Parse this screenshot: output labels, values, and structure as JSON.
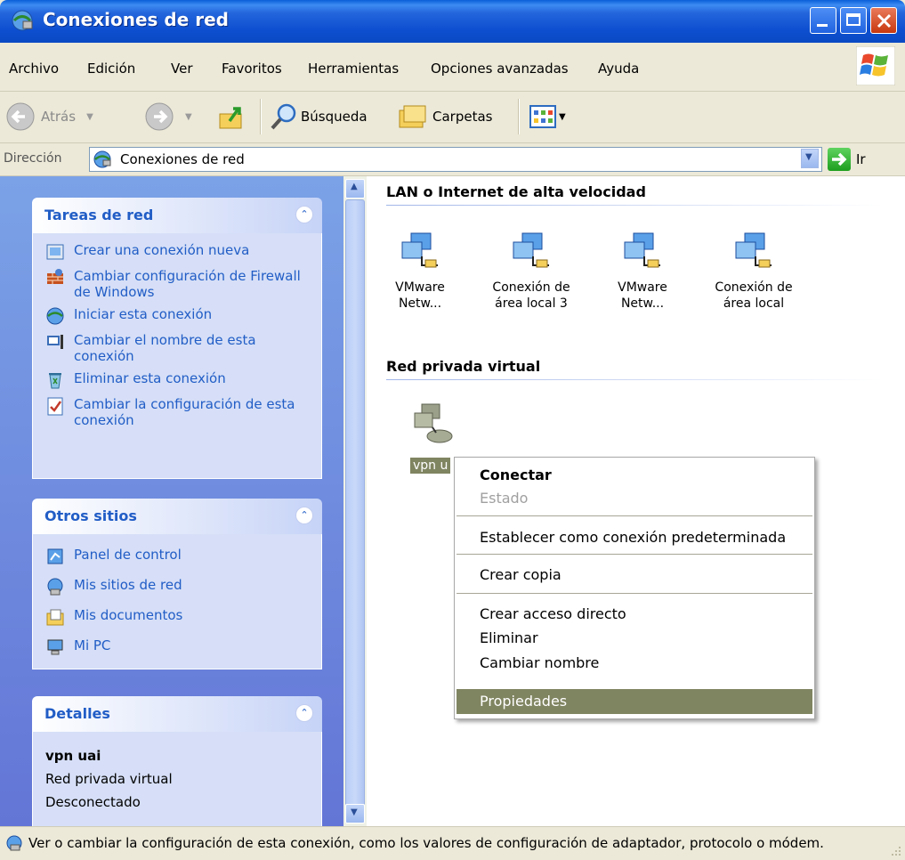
{
  "window": {
    "title": "Conexiones de red"
  },
  "menu": [
    "Archivo",
    "Edición",
    "Ver",
    "Favoritos",
    "Herramientas",
    "Opciones avanzadas",
    "Ayuda"
  ],
  "toolbar": {
    "back": "Atrás",
    "search": "Búsqueda",
    "folders": "Carpetas"
  },
  "address": {
    "label": "Dirección",
    "value": "Conexiones de red",
    "go": "Ir"
  },
  "tasks_panel": {
    "title": "Tareas de red",
    "items": [
      "Crear una conexión nueva",
      "Cambiar configuración de Firewall de Windows",
      "Iniciar esta conexión",
      "Cambiar el nombre de esta conexión",
      "Eliminar esta conexión",
      "Cambiar la configuración de esta conexión"
    ]
  },
  "places_panel": {
    "title": "Otros sitios",
    "items": [
      "Panel de control",
      "Mis sitios de red",
      "Mis documentos",
      "Mi PC"
    ]
  },
  "details_panel": {
    "title": "Detalles",
    "name": "vpn uai",
    "type": "Red privada virtual",
    "status": "Desconectado"
  },
  "groups": {
    "lan": {
      "title": "LAN o Internet de alta velocidad",
      "connections": [
        {
          "line1": "VMware",
          "line2": "Netw..."
        },
        {
          "line1": "Conexión de",
          "line2": "área local 3"
        },
        {
          "line1": "VMware",
          "line2": "Netw..."
        },
        {
          "line1": "Conexión de",
          "line2": "área local"
        }
      ]
    },
    "vpn": {
      "title": "Red privada virtual",
      "selected_label": "vpn u"
    }
  },
  "context_menu": {
    "connect": "Conectar",
    "status": "Estado",
    "set_default": "Establecer como conexión predeterminada",
    "copy": "Crear copia",
    "shortcut": "Crear acceso directo",
    "delete": "Eliminar",
    "rename": "Cambiar nombre",
    "properties": "Propiedades"
  },
  "statusbar": {
    "text": "Ver o cambiar la configuración de esta conexión, como los valores de configuración de adaptador, protocolo o módem."
  }
}
